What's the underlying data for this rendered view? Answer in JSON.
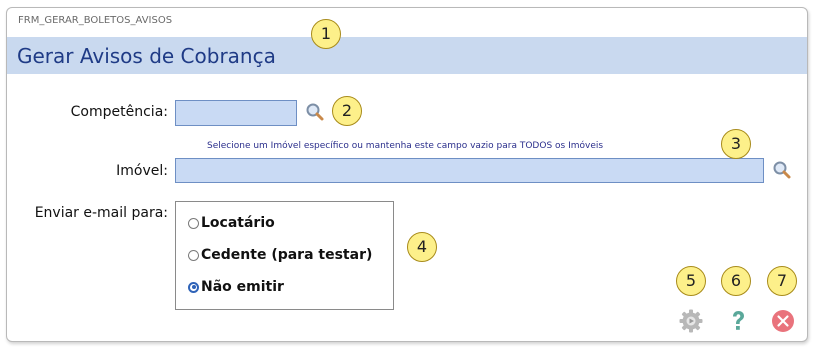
{
  "form": {
    "id": "FRM_GERAR_BOLETOS_AVISOS",
    "title": "Gerar Avisos de Cobrança"
  },
  "fields": {
    "competencia": {
      "label": "Competência:",
      "value": "",
      "lookup_icon": "search-icon"
    },
    "imovel": {
      "label": "Imóvel:",
      "value": "",
      "hint": "Selecione um Imóvel específico ou mantenha este campo vazio para TODOS os Imóveis",
      "lookup_icon": "search-icon"
    },
    "enviar_email": {
      "label": "Enviar e-mail para:",
      "options": [
        {
          "label": "Locatário",
          "checked": false
        },
        {
          "label": "Cedente (para testar)",
          "checked": false
        },
        {
          "label": "Não emitir",
          "checked": true
        }
      ]
    }
  },
  "toolbar": {
    "execute_icon": "gear-icon",
    "help_icon": "question-icon",
    "close_icon": "close-icon"
  },
  "callouts": [
    "1",
    "2",
    "3",
    "4",
    "5",
    "6",
    "7"
  ],
  "colors": {
    "title_bar_bg": "#c9d9ef",
    "title_text": "#1f3b86",
    "input_bg": "#c9daf4",
    "hint_text": "#2b2f8c",
    "callout_bg": "#fdf08a",
    "help_green": "#5aa89a",
    "close_red": "#e9737c",
    "gear_gray": "#b8b8b8"
  }
}
